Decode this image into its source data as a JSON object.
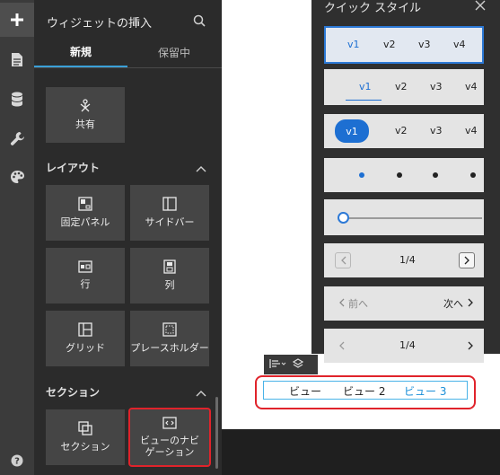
{
  "rail": {
    "items": [
      {
        "icon": "plus-icon",
        "active": true
      },
      {
        "icon": "page-icon"
      },
      {
        "icon": "database-icon"
      },
      {
        "icon": "wrench-icon"
      },
      {
        "icon": "palette-icon"
      }
    ],
    "help_icon": "question-icon"
  },
  "panel": {
    "title": "ウィジェットの挿入",
    "search_icon": "search-icon",
    "tabs": [
      "新規",
      "保留中"
    ],
    "shared": {
      "label": "共有",
      "icon": "share-icon"
    },
    "layout_section": {
      "label": "レイアウト",
      "tiles": [
        {
          "label": "固定パネル",
          "icon": "fixed-panel-icon"
        },
        {
          "label": "サイドバー",
          "icon": "sidebar-icon"
        },
        {
          "label": "行",
          "icon": "row-icon"
        },
        {
          "label": "列",
          "icon": "column-icon"
        },
        {
          "label": "グリッド",
          "icon": "grid-icon"
        },
        {
          "label": "プレースホルダー",
          "icon": "placeholder-icon"
        }
      ]
    },
    "section_section": {
      "label": "セクション",
      "tiles": [
        {
          "label": "セクション",
          "icon": "section-icon"
        },
        {
          "label": "ビューのナビゲーション",
          "icon": "view-navigation-icon"
        }
      ]
    }
  },
  "quick_style": {
    "title": "クイック スタイル",
    "close_icon": "close-icon",
    "tab_labels": [
      "v1",
      "v2",
      "v3",
      "v4"
    ],
    "pager_text": "1/4",
    "prev_label": "前へ",
    "next_label": "次へ",
    "accent": "#1d6fd2"
  },
  "view_nav": {
    "items": [
      "ビュー",
      "ビュー 2",
      "ビュー 3"
    ],
    "active_index": 2
  }
}
